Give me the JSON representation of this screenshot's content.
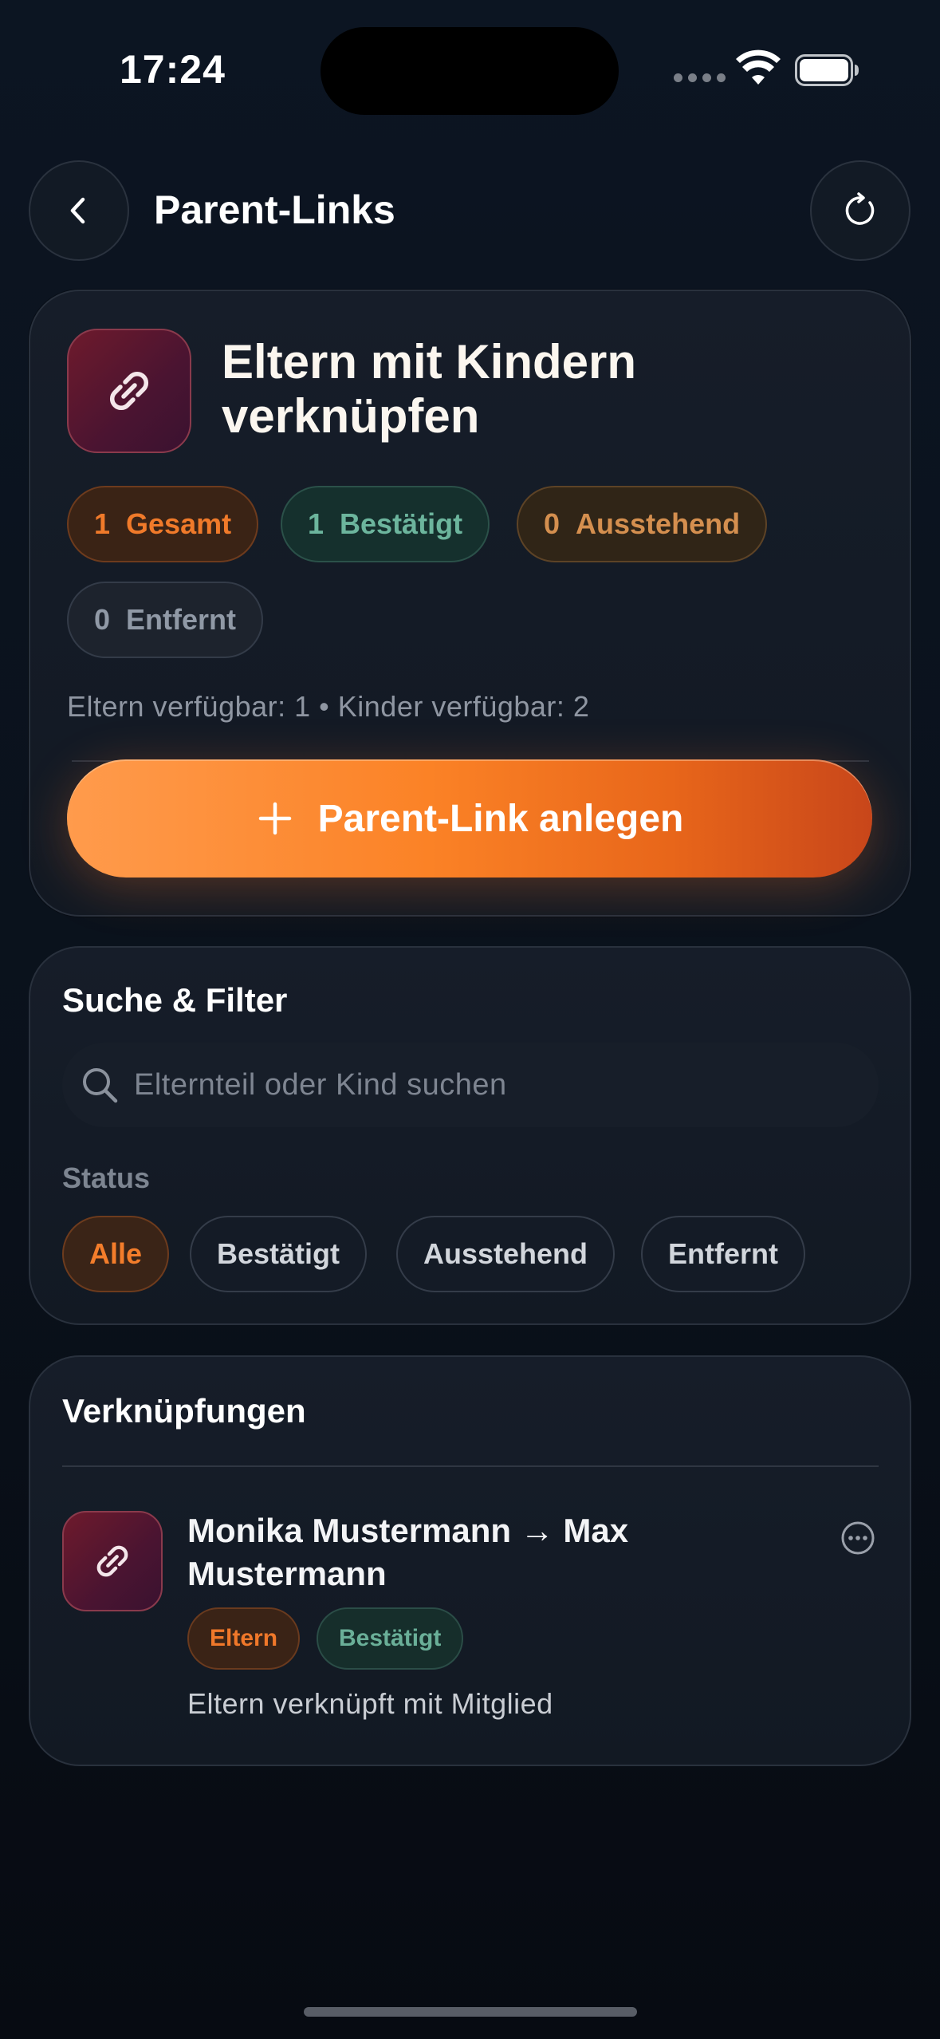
{
  "status_bar": {
    "time": "17:24"
  },
  "header": {
    "title": "Parent-Links",
    "back_icon": "chevron-left-icon",
    "refresh_icon": "refresh-icon"
  },
  "hero": {
    "icon": "link-icon",
    "title": "Eltern mit Kindern verknüpfen",
    "stats": [
      {
        "count": "1",
        "label": "Gesamt",
        "color": "#f07a2a"
      },
      {
        "count": "1",
        "label": "Bestätigt",
        "color": "#6cb59d"
      },
      {
        "count": "0",
        "label": "Ausstehend",
        "color": "#d48f4f"
      },
      {
        "count": "0",
        "label": "Entfernt",
        "color": "#9099a6"
      }
    ],
    "availability": "Eltern verfügbar: 1 • Kinder verfügbar: 2",
    "cta_label": "Parent-Link anlegen",
    "cta_color": "#fb8226"
  },
  "filter": {
    "title": "Suche & Filter",
    "search_placeholder": "Elternteil oder Kind suchen",
    "status_label": "Status",
    "chips": [
      "Alle",
      "Bestätigt",
      "Ausstehend",
      "Entfernt"
    ],
    "active_chip": "Alle"
  },
  "links": {
    "title": "Verknüpfungen",
    "items": [
      {
        "title": "Monika Mustermann → Max Mustermann",
        "tags": [
          "Eltern",
          "Bestätigt"
        ],
        "subtitle": "Eltern verknüpft mit Mitglied"
      }
    ]
  }
}
